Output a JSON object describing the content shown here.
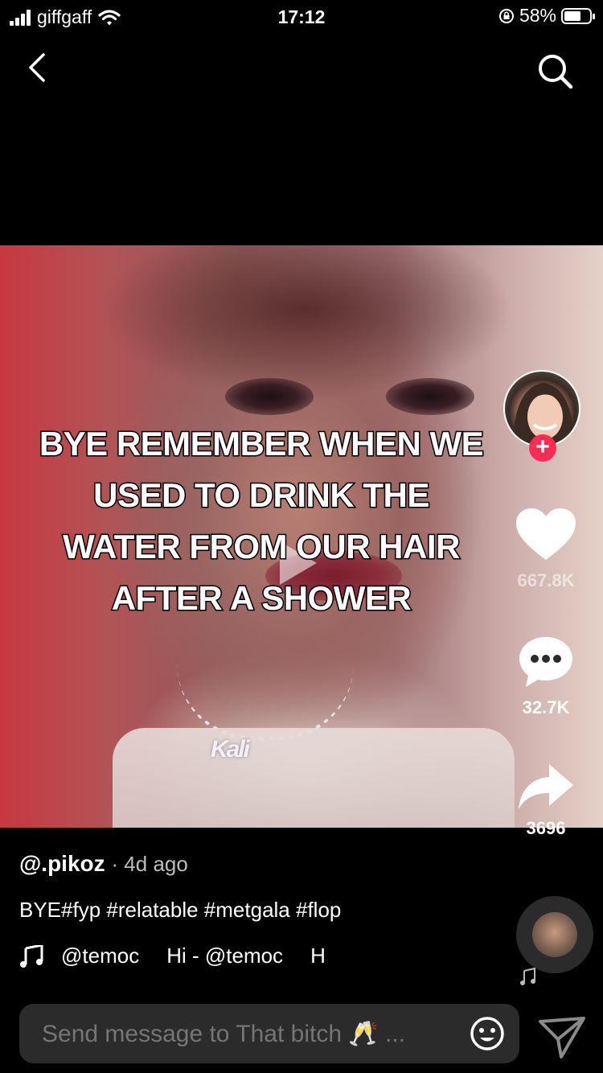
{
  "status_bar": {
    "carrier": "giffgaff",
    "time": "17:12",
    "battery_percent": "58%",
    "battery_level": 0.58
  },
  "nav": {
    "back_icon": "chevron-left-icon",
    "search_icon": "search-icon"
  },
  "video": {
    "overlay_lines": [
      "BYE REMEMBER WHEN WE",
      "USED TO DRINK THE",
      "WATER FROM OUR HAIR",
      "AFTER A SHOWER"
    ],
    "pendant_text": "Kali"
  },
  "actions": {
    "follow_label": "+",
    "likes": "667.8K",
    "comments": "32.7K",
    "shares": "3696"
  },
  "post": {
    "author": "@.pikoz",
    "posted": "· 4d ago",
    "caption": "BYE#fyp #relatable #metgala #flop",
    "music_parts": [
      "@temoc",
      "Hi - @temoc",
      "H"
    ]
  },
  "composer": {
    "placeholder": "Send message to That bitch 🥂 ..."
  },
  "colors": {
    "follow": "#fe2c55",
    "background": "#000000",
    "composer_bg": "#2b2b2b"
  }
}
